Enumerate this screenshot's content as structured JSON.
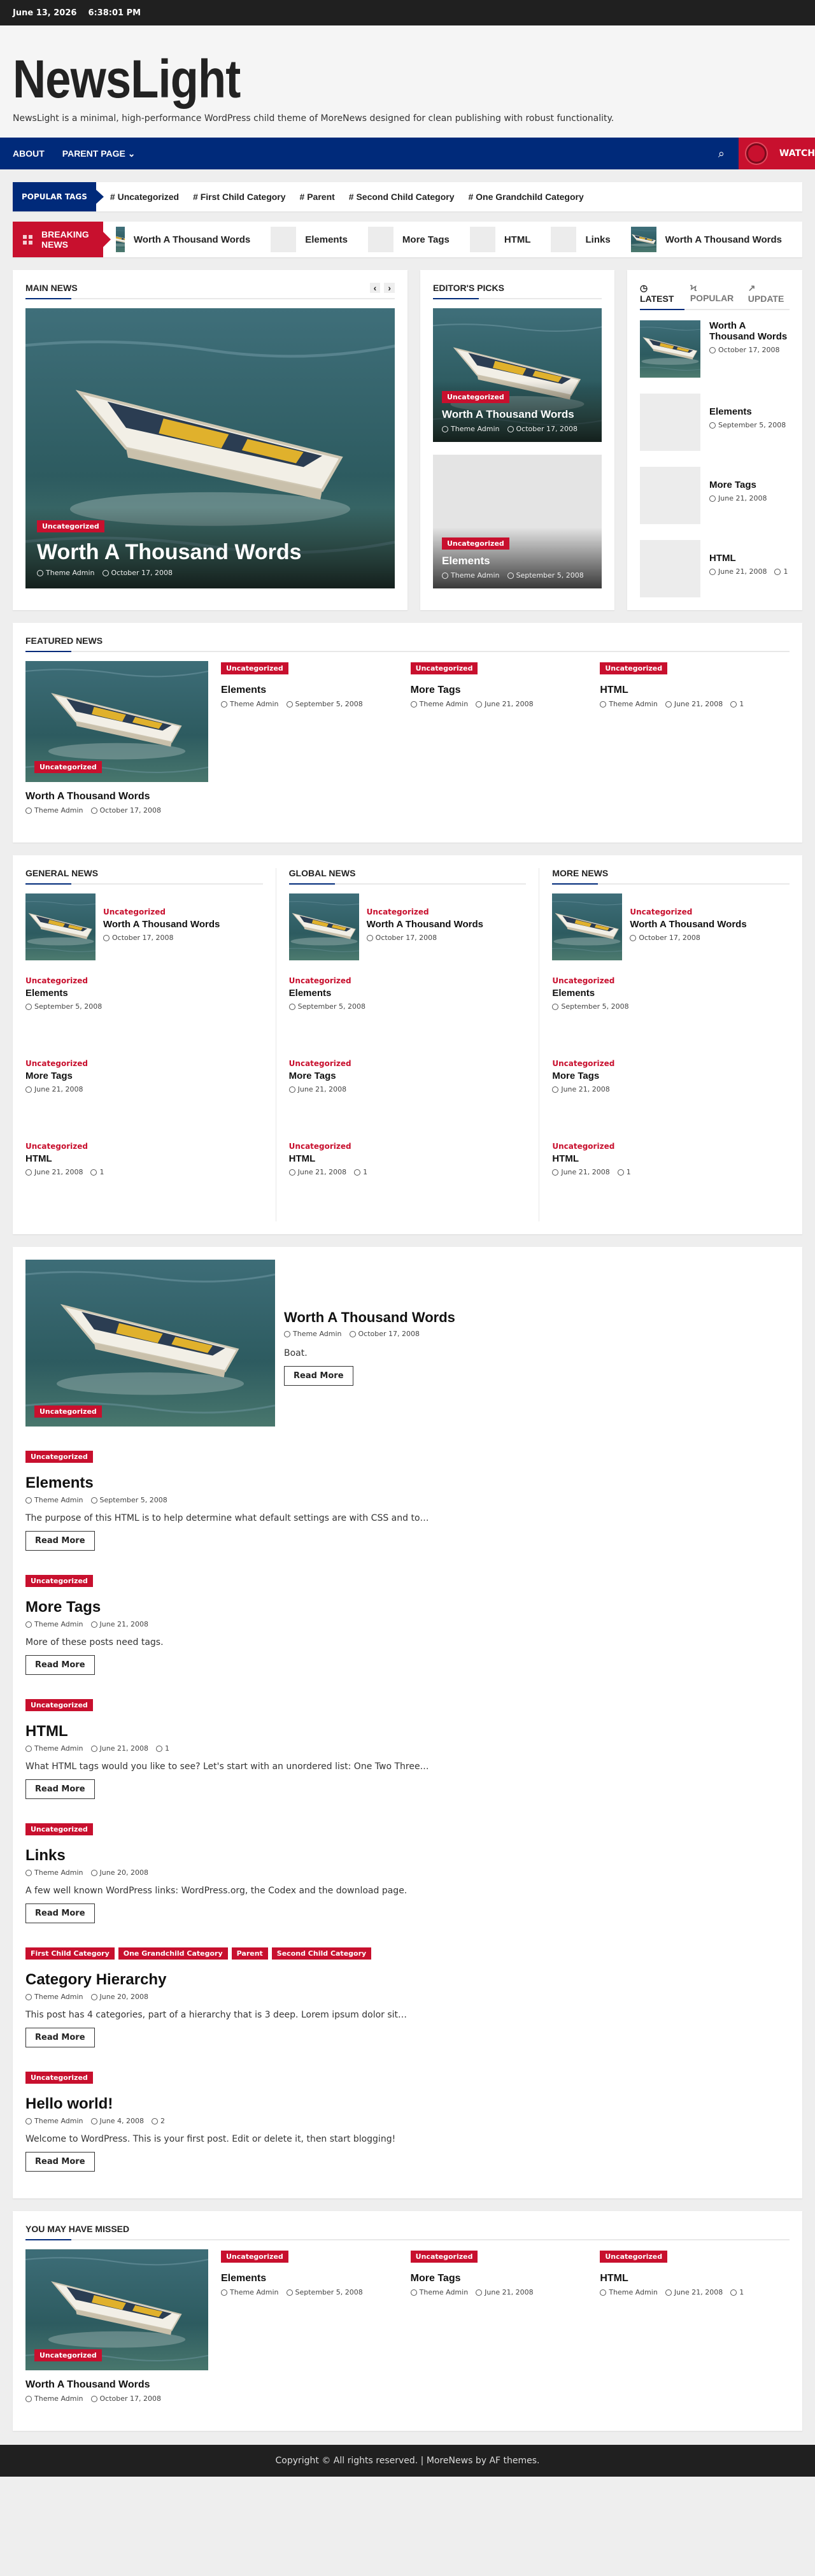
{
  "topbar": {
    "date": "June 13, 2026",
    "time": "6:38:01 PM"
  },
  "site": {
    "title": "NewsLight",
    "description": "NewsLight is a minimal, high-performance WordPress child theme of MoreNews designed for clean publishing with robust functionality."
  },
  "nav": {
    "items": [
      "ABOUT",
      "PARENT PAGE"
    ],
    "watch_label": "WATCH"
  },
  "popular_tags": {
    "label": "POPULAR TAGS",
    "tags": [
      "# Uncategorized",
      "# First Child Category",
      "# Parent",
      "# Second Child Category",
      "# One Grandchild Category"
    ]
  },
  "breaking": {
    "label": "BREAKING NEWS",
    "items": [
      "Worth A Thousand Words",
      "Elements",
      "More Tags",
      "HTML",
      "Links",
      "Worth A Thousand Words"
    ]
  },
  "main_news": {
    "title": "MAIN NEWS",
    "category": "Uncategorized",
    "headline": "Worth A Thousand Words",
    "author": "Theme Admin",
    "date": "October 17, 2008"
  },
  "editors_picks": {
    "title": "EDITOR'S PICKS",
    "items": [
      {
        "category": "Uncategorized",
        "headline": "Worth A Thousand Words",
        "author": "Theme Admin",
        "date": "October 17, 2008"
      },
      {
        "category": "Uncategorized",
        "headline": "Elements",
        "author": "Theme Admin",
        "date": "September 5, 2008"
      }
    ]
  },
  "tabs": {
    "labels": [
      "LATEST",
      "POPULAR",
      "UPDATE"
    ],
    "items": [
      {
        "headline": "Worth A Thousand Words",
        "date": "October 17, 2008",
        "comments": ""
      },
      {
        "headline": "Elements",
        "date": "September 5, 2008",
        "comments": ""
      },
      {
        "headline": "More Tags",
        "date": "June 21, 2008",
        "comments": ""
      },
      {
        "headline": "HTML",
        "date": "June 21, 2008",
        "comments": "1"
      }
    ]
  },
  "featured": {
    "title": "FEATURED NEWS",
    "main": {
      "category": "Uncategorized",
      "headline": "Worth A Thousand Words",
      "author": "Theme Admin",
      "date": "October 17, 2008"
    },
    "items": [
      {
        "category": "Uncategorized",
        "headline": "Elements",
        "author": "Theme Admin",
        "date": "September 5, 2008",
        "comments": ""
      },
      {
        "category": "Uncategorized",
        "headline": "More Tags",
        "author": "Theme Admin",
        "date": "June 21, 2008",
        "comments": ""
      },
      {
        "category": "Uncategorized",
        "headline": "HTML",
        "author": "Theme Admin",
        "date": "June 21, 2008",
        "comments": "1"
      }
    ]
  },
  "columns": [
    {
      "title": "GENERAL NEWS"
    },
    {
      "title": "GLOBAL NEWS"
    },
    {
      "title": "MORE NEWS"
    }
  ],
  "column_items": [
    {
      "category": "Uncategorized",
      "headline": "Worth A Thousand Words",
      "date": "October 17, 2008",
      "comments": ""
    },
    {
      "category": "Uncategorized",
      "headline": "Elements",
      "date": "September 5, 2008",
      "comments": ""
    },
    {
      "category": "Uncategorized",
      "headline": "More Tags",
      "date": "June 21, 2008",
      "comments": ""
    },
    {
      "category": "Uncategorized",
      "headline": "HTML",
      "date": "June 21, 2008",
      "comments": "1"
    }
  ],
  "posts": [
    {
      "categories": [
        "Uncategorized"
      ],
      "headline": "Worth A Thousand Words",
      "author": "Theme Admin",
      "date": "October 17, 2008",
      "comments": "",
      "excerpt": "Boat."
    },
    {
      "categories": [
        "Uncategorized"
      ],
      "headline": "Elements",
      "author": "Theme Admin",
      "date": "September 5, 2008",
      "comments": "",
      "excerpt": "The purpose of this HTML is to help determine what default settings are with CSS and to…"
    },
    {
      "categories": [
        "Uncategorized"
      ],
      "headline": "More Tags",
      "author": "Theme Admin",
      "date": "June 21, 2008",
      "comments": "",
      "excerpt": "More of these posts need tags."
    },
    {
      "categories": [
        "Uncategorized"
      ],
      "headline": "HTML",
      "author": "Theme Admin",
      "date": "June 21, 2008",
      "comments": "1",
      "excerpt": "What HTML tags would you like to see? Let's start with an unordered list: One Two Three…"
    },
    {
      "categories": [
        "Uncategorized"
      ],
      "headline": "Links",
      "author": "Theme Admin",
      "date": "June 20, 2008",
      "comments": "",
      "excerpt": "A few well known WordPress links: WordPress.org, the Codex and the download page."
    },
    {
      "categories": [
        "First Child Category",
        "One Grandchild Category",
        "Parent",
        "Second Child Category"
      ],
      "headline": "Category Hierarchy",
      "author": "Theme Admin",
      "date": "June 20, 2008",
      "comments": "",
      "excerpt": "This post has 4 categories, part of a hierarchy that is 3 deep. Lorem ipsum dolor sit…"
    },
    {
      "categories": [
        "Uncategorized"
      ],
      "headline": "Hello world!",
      "author": "Theme Admin",
      "date": "June 4, 2008",
      "comments": "2",
      "excerpt": "Welcome to WordPress. This is your first post. Edit or delete it, then start blogging!"
    }
  ],
  "read_more_label": "Read More",
  "missed": {
    "title": "YOU MAY HAVE MISSED",
    "main": {
      "category": "Uncategorized",
      "headline": "Worth A Thousand Words",
      "author": "Theme Admin",
      "date": "October 17, 2008"
    },
    "items": [
      {
        "category": "Uncategorized",
        "headline": "Elements",
        "author": "Theme Admin",
        "date": "September 5, 2008",
        "comments": ""
      },
      {
        "category": "Uncategorized",
        "headline": "More Tags",
        "author": "Theme Admin",
        "date": "June 21, 2008",
        "comments": ""
      },
      {
        "category": "Uncategorized",
        "headline": "HTML",
        "author": "Theme Admin",
        "date": "June 21, 2008",
        "comments": "1"
      }
    ]
  },
  "footer": {
    "text": "Copyright © All rights reserved.  |  MoreNews by AF themes."
  },
  "colors": {
    "brand": "#002a7a",
    "accent": "#c8102e"
  }
}
